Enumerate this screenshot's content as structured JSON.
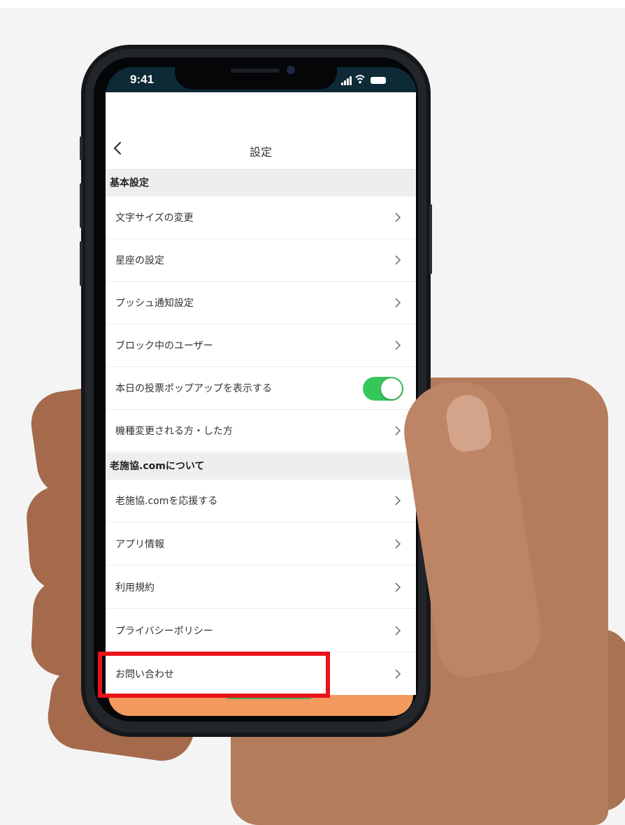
{
  "status_bar": {
    "time": "9:41"
  },
  "nav": {
    "title": "設定",
    "back_icon": "chevron-left-icon"
  },
  "sections": [
    {
      "header": "基本設定",
      "rows": [
        {
          "label": "文字サイズの変更",
          "control": "chevron"
        },
        {
          "label": "星座の設定",
          "control": "chevron"
        },
        {
          "label": "プッシュ通知設定",
          "control": "chevron"
        },
        {
          "label": "ブロック中のユーザー",
          "control": "chevron"
        },
        {
          "label": "本日の投票ポップアップを表示する",
          "control": "toggle",
          "toggle_on": true
        },
        {
          "label": "機種変更される方・した方",
          "control": "chevron"
        }
      ]
    },
    {
      "header": "老施協.comについて",
      "rows": [
        {
          "label": "老施協.comを応援する",
          "control": "chevron"
        },
        {
          "label": "アプリ情報",
          "control": "chevron"
        },
        {
          "label": "利用規約",
          "control": "chevron"
        },
        {
          "label": "プライバシーポリシー",
          "control": "chevron"
        },
        {
          "label": "お問い合わせ",
          "control": "chevron",
          "highlighted": true
        }
      ]
    }
  ],
  "colors": {
    "toggle_on": "#36c75a",
    "highlight_box": "#e8131b",
    "section_bg": "#eeeeee"
  }
}
